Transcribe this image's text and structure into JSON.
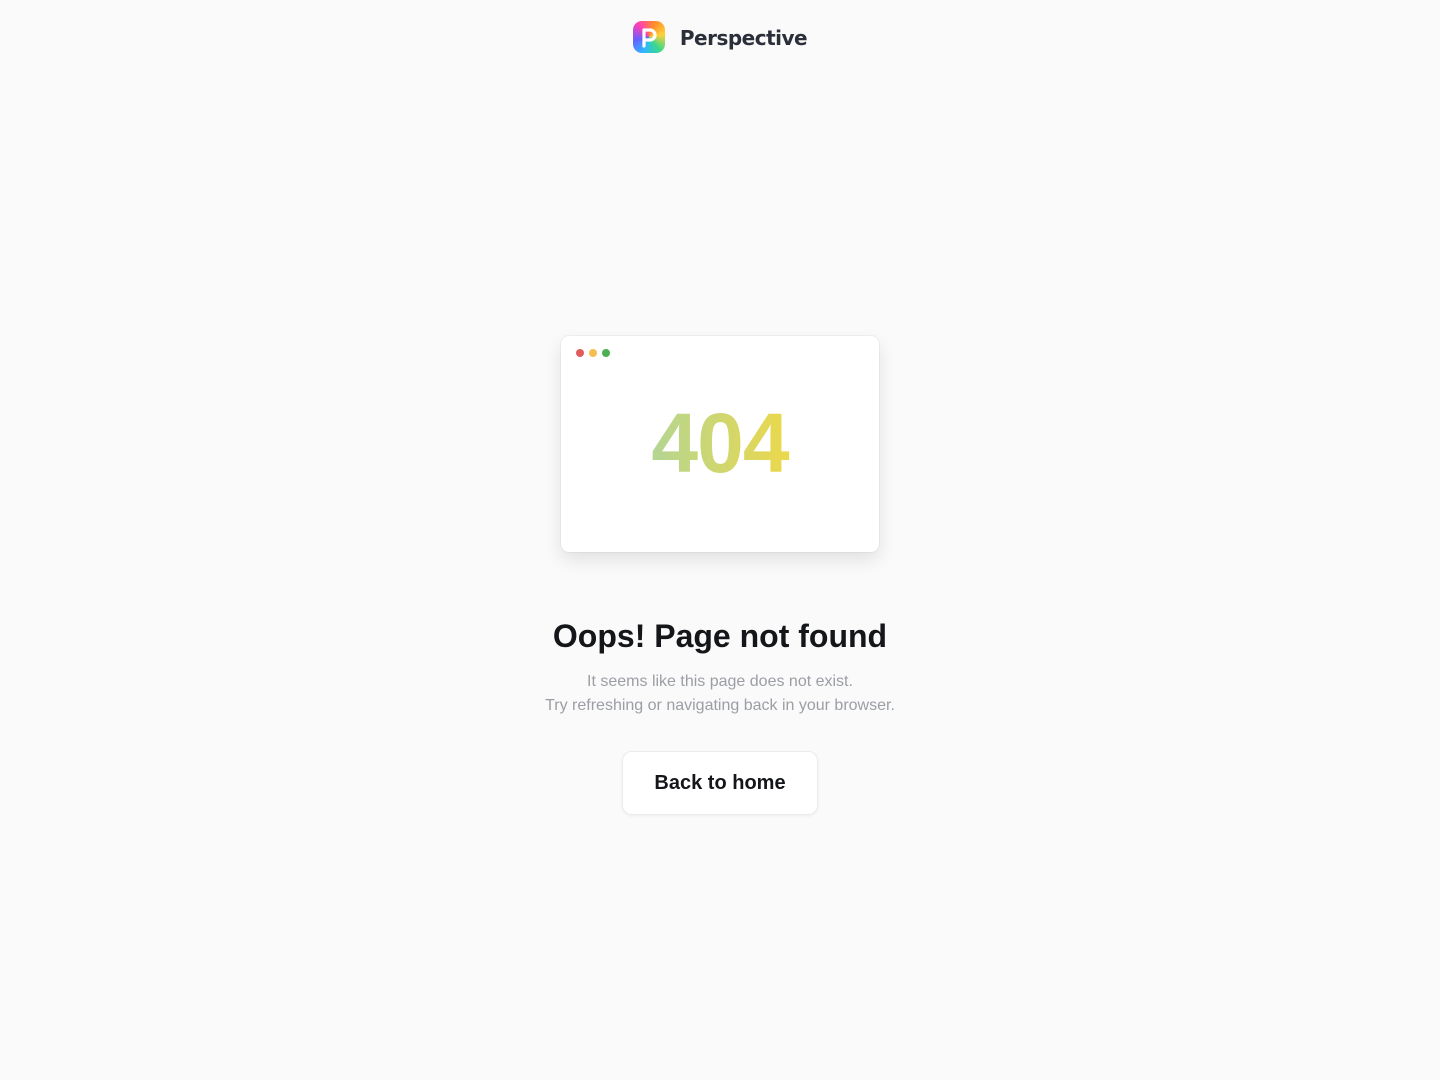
{
  "brand": {
    "name": "Perspective",
    "logo_icon": "perspective-logo-icon",
    "logo_letter": "p"
  },
  "illustration": {
    "window_dots": [
      {
        "name": "close-dot",
        "color": "#e05d5d"
      },
      {
        "name": "minimize-dot",
        "color": "#f4bf4f"
      },
      {
        "name": "maximize-dot",
        "color": "#4caf50"
      }
    ],
    "error_code": "404"
  },
  "message": {
    "title": "Oops! Page not found",
    "line1": "It seems like this page does not exist.",
    "line2": "Try refreshing or navigating back in your browser."
  },
  "actions": {
    "back_home_label": "Back to home"
  },
  "colors": {
    "background": "#fafafa",
    "title": "#15161a",
    "muted_text": "#9b9ea4",
    "code_gradient_start": "#b6d590",
    "code_gradient_end": "#f0d845"
  }
}
